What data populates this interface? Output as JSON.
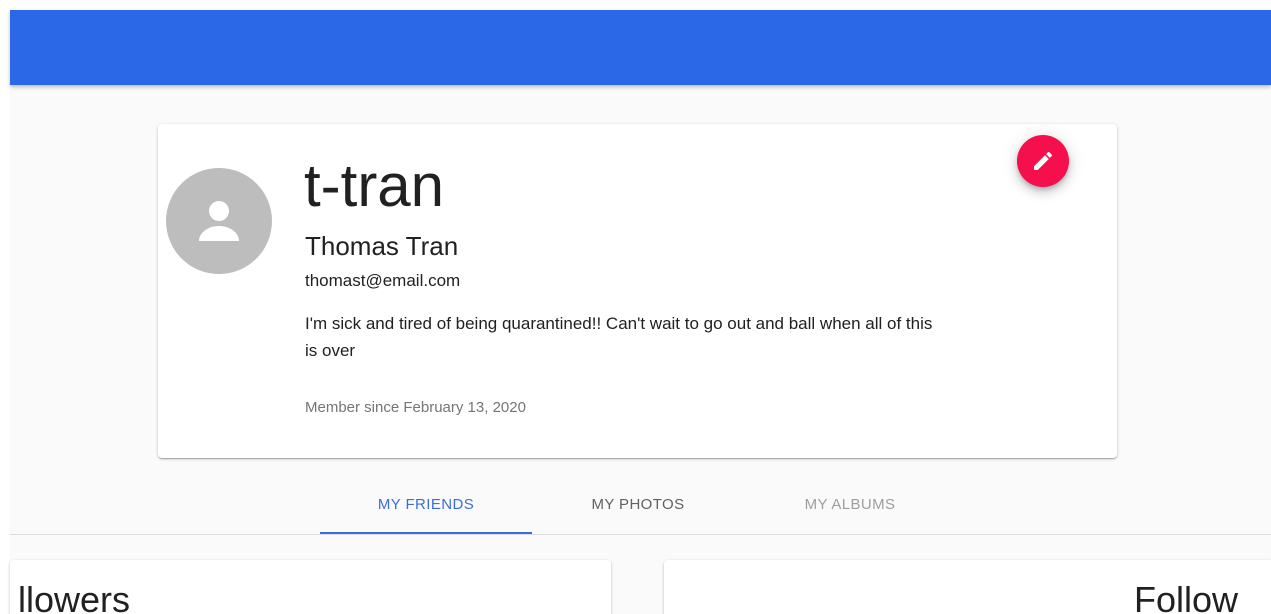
{
  "app_bar": {
    "color": "#2a68e7"
  },
  "profile": {
    "username": "t-tran",
    "full_name": "Thomas Tran",
    "email": "thomast@email.com",
    "bio": "I'm sick and tired of being quarantined!! Can't wait to go out and ball when all of this is over",
    "member_since": "Member since February 13, 2020",
    "avatar_icon": "person-icon",
    "edit_icon": "pencil-icon",
    "edit_color": "#f50f4c"
  },
  "tabs": [
    {
      "label": "MY FRIENDS",
      "active": true
    },
    {
      "label": "MY PHOTOS",
      "active": false
    },
    {
      "label": "MY ALBUMS",
      "active": false
    }
  ],
  "panels": {
    "left_title": "llowers",
    "right_title": "Follow"
  },
  "colors": {
    "accent": "#3a6fd8"
  }
}
